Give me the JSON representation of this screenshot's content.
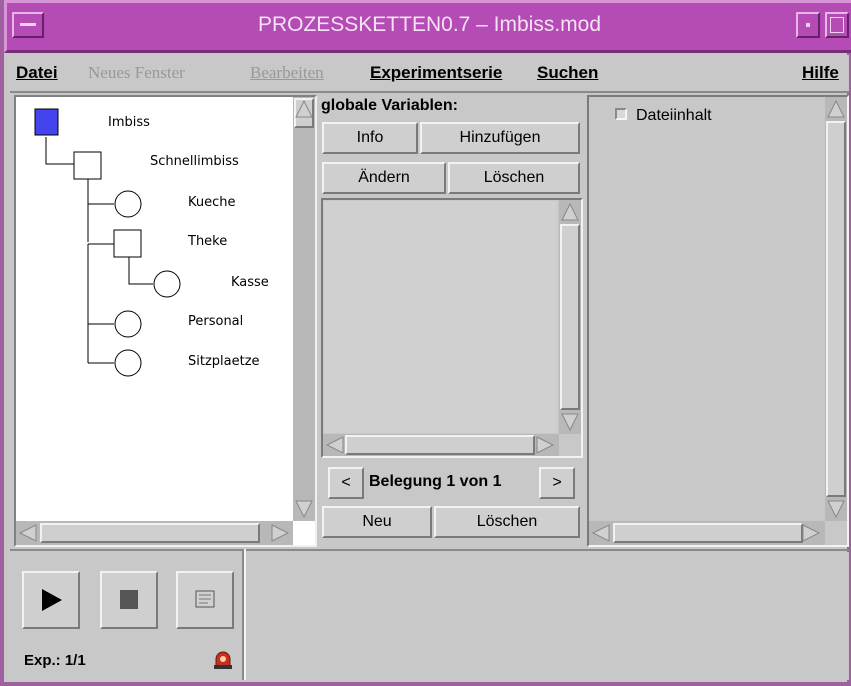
{
  "window": {
    "title": "PROZESSKETTEN0.7 – Imbiss.mod"
  },
  "menu": {
    "datei": "Datei",
    "neues_fenster": "Neues Fenster",
    "bearbeiten": "Bearbeiten",
    "experimentserie": "Experimentserie",
    "suchen": "Suchen",
    "hilfe": "Hilfe"
  },
  "tree": {
    "nodes": [
      {
        "label": "Imbiss",
        "shape": "square-filled"
      },
      {
        "label": "Schnellimbiss",
        "shape": "square"
      },
      {
        "label": "Kueche",
        "shape": "circle"
      },
      {
        "label": "Theke",
        "shape": "square"
      },
      {
        "label": "Kasse",
        "shape": "circle"
      },
      {
        "label": "Personal",
        "shape": "circle"
      },
      {
        "label": "Sitzplaetze",
        "shape": "circle"
      }
    ]
  },
  "variables": {
    "heading": "globale Variablen:",
    "info_label": "Info",
    "add_label": "Hinzufügen",
    "edit_label": "Ändern",
    "delete_label": "Löschen",
    "prev_label": "<",
    "next_label": ">",
    "assignment_label": "Belegung 1 von 1",
    "new_label": "Neu",
    "delete2_label": "Löschen"
  },
  "file_panel": {
    "checkbox_label": "Dateiinhalt",
    "checked": false
  },
  "experiment": {
    "status_label": "Exp.: 1/1"
  },
  "colors": {
    "title_bar": "#b54bb5",
    "node_fill": "#4444ee",
    "alarm": "#c8301e"
  },
  "icons": {
    "play": "play-icon",
    "stop": "stop-icon",
    "log": "log-icon",
    "alarm": "alarm-icon"
  }
}
